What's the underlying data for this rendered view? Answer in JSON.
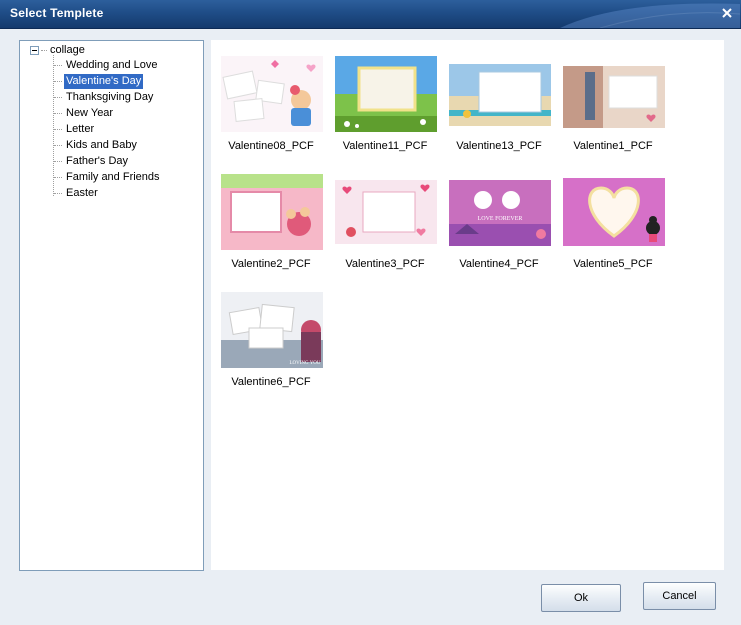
{
  "window": {
    "title": "Select Templete"
  },
  "tree": {
    "root": "collage",
    "items": [
      {
        "label": "Wedding and Love"
      },
      {
        "label": "Valentine's Day",
        "selected": true
      },
      {
        "label": "Thanksgiving Day"
      },
      {
        "label": "New Year"
      },
      {
        "label": "Letter"
      },
      {
        "label": "Kids and Baby"
      },
      {
        "label": "Father's Day"
      },
      {
        "label": "Family and Friends"
      },
      {
        "label": "Easter"
      }
    ]
  },
  "templates": [
    {
      "name": "Valentine08_PCF"
    },
    {
      "name": "Valentine11_PCF"
    },
    {
      "name": "Valentine13_PCF"
    },
    {
      "name": "Valentine1_PCF"
    },
    {
      "name": "Valentine2_PCF"
    },
    {
      "name": "Valentine3_PCF"
    },
    {
      "name": "Valentine4_PCF"
    },
    {
      "name": "Valentine5_PCF"
    },
    {
      "name": "Valentine6_PCF"
    }
  ],
  "thumb_texts": {
    "love_forever": "LOVE FOREVER",
    "loving": "LOVING YOU"
  },
  "buttons": {
    "ok": "Ok",
    "cancel": "Cancel"
  },
  "colors": {
    "title_bar": "#1f4d87",
    "selection": "#316ac5",
    "panel_border": "#7f9db9"
  }
}
